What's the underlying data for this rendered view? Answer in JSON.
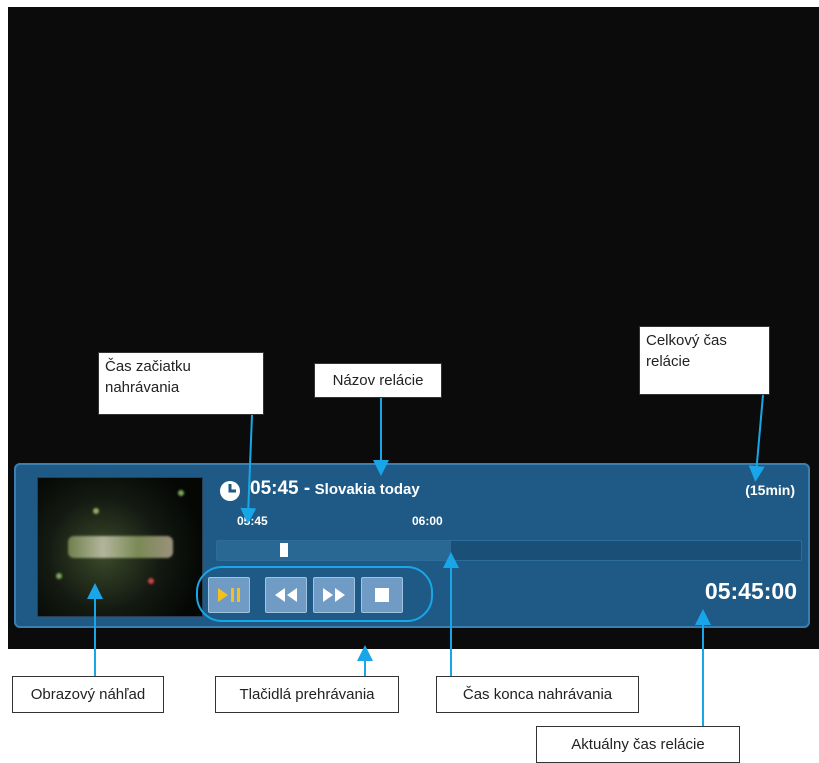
{
  "osd": {
    "start_time": "05:45 -",
    "program_title": "Slovakia today",
    "total_duration": "(15min)",
    "timeline_start": "05:45",
    "timeline_end": "06:00",
    "current_time": "05:45:00",
    "recording_progress": 0.4
  },
  "controls": {
    "buttons": [
      "play-pause",
      "rewind",
      "fast-forward",
      "stop"
    ]
  },
  "callouts": {
    "start_time": "Čas začiatku nahrávania",
    "program_name": "Názov relácie",
    "total_time": "Celkový čas relácie",
    "preview": "Obrazový náhľad",
    "playback_buttons": "Tlačidlá prehrávania",
    "end_time": "Čas konca nahrávania",
    "current_time": "Aktuálny čas relácie"
  },
  "colors": {
    "accent": "#19a6e8",
    "osd_background": "#1e5a85",
    "play_icon": "#f3c020"
  }
}
